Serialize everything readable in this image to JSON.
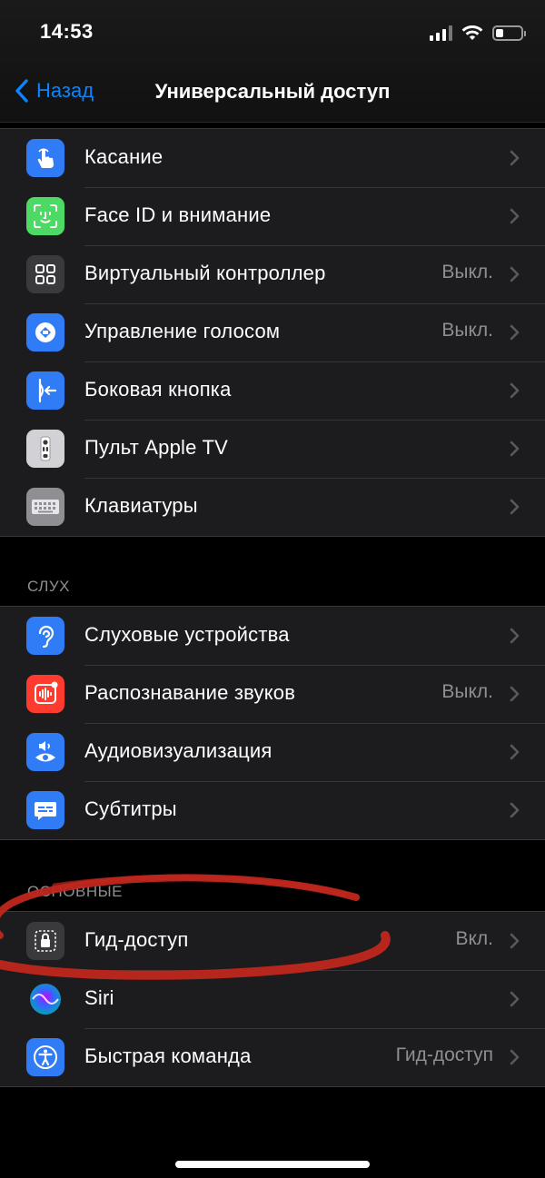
{
  "status": {
    "time": "14:53",
    "battery_level": 0.3
  },
  "nav": {
    "back_label": "Назад",
    "title": "Универсальный доступ"
  },
  "groups": [
    {
      "header": "",
      "items": [
        {
          "label": "Касание",
          "value": "",
          "icon": "hand-icon",
          "color": "#2f7cf6"
        },
        {
          "label": "Face ID и внимание",
          "value": "",
          "icon": "faceid-icon",
          "color": "#4cd964"
        },
        {
          "label": "Виртуальный контроллер",
          "value": "Выкл.",
          "icon": "grid-icon",
          "color": "#3a3a3c"
        },
        {
          "label": "Управление голосом",
          "value": "Выкл.",
          "icon": "voice-control-icon",
          "color": "#2f7cf6"
        },
        {
          "label": "Боковая кнопка",
          "value": "",
          "icon": "side-button-icon",
          "color": "#2f7cf6"
        },
        {
          "label": "Пульт Apple TV",
          "value": "",
          "icon": "remote-icon",
          "color": "#8e8e93"
        },
        {
          "label": "Клавиатуры",
          "value": "",
          "icon": "keyboard-icon",
          "color": "#8e8e93"
        }
      ]
    },
    {
      "header": "СЛУХ",
      "items": [
        {
          "label": "Слуховые устройства",
          "value": "",
          "icon": "ear-icon",
          "color": "#2f7cf6"
        },
        {
          "label": "Распознавание звуков",
          "value": "Выкл.",
          "icon": "sound-recognition-icon",
          "color": "#ff3b30"
        },
        {
          "label": "Аудиовизуализация",
          "value": "",
          "icon": "audio-visual-icon",
          "color": "#2f7cf6"
        },
        {
          "label": "Субтитры",
          "value": "",
          "icon": "subtitles-icon",
          "color": "#2f7cf6"
        }
      ]
    },
    {
      "header": "ОСНОВНЫЕ",
      "items": [
        {
          "label": "Гид-доступ",
          "value": "Вкл.",
          "icon": "lock-icon",
          "color": "#3a3a3c"
        },
        {
          "label": "Siri",
          "value": "",
          "icon": "siri-icon",
          "color": "#1c1c1e"
        },
        {
          "label": "Быстрая команда",
          "value": "Гид-доступ",
          "icon": "accessibility-icon",
          "color": "#2f7cf6"
        }
      ]
    }
  ]
}
